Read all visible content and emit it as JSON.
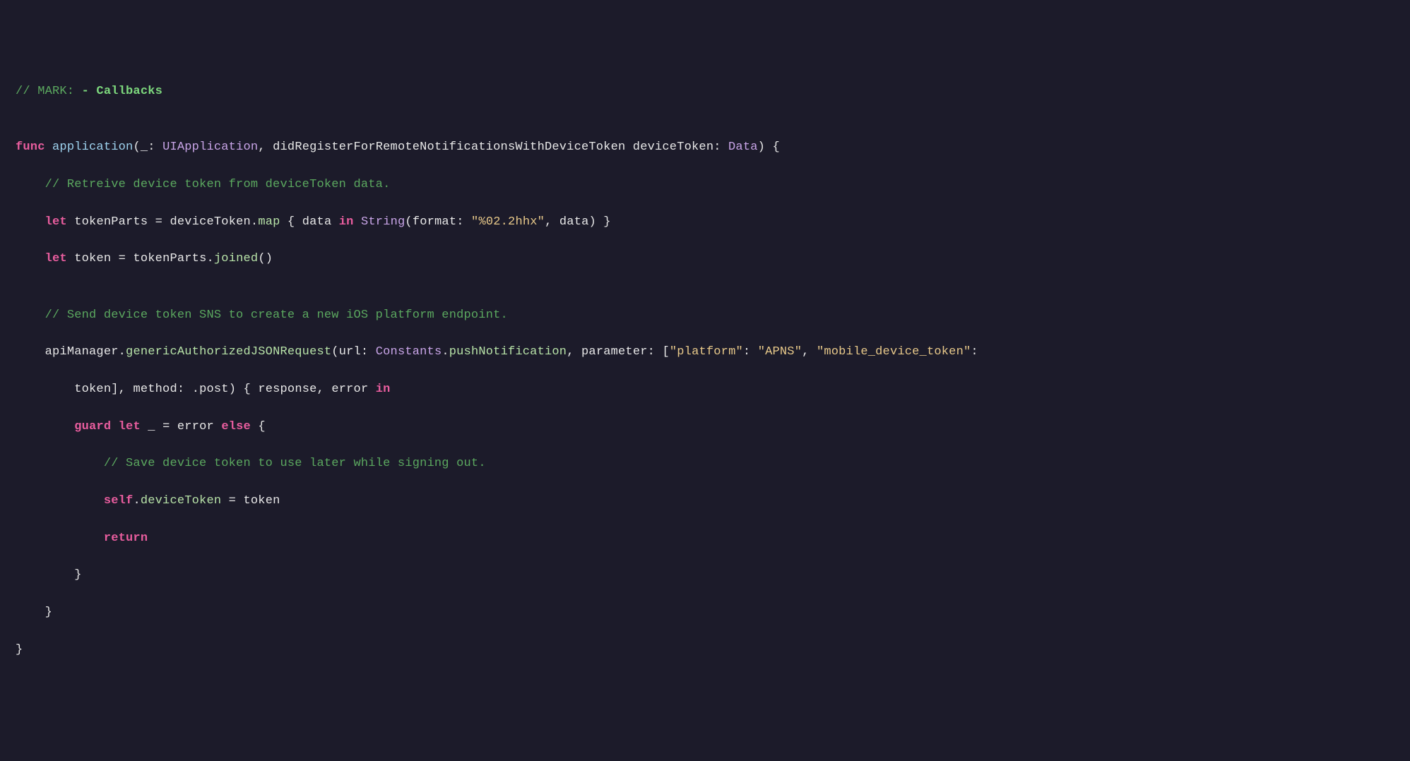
{
  "code": {
    "c1_prefix": "// MARK: ",
    "c1_bold": "- Callbacks",
    "kw_func": "func",
    "fn_application": "application",
    "p_open": "(",
    "underscore": "_",
    "colon_sp": ": ",
    "t_uiapplication": "UIApplication",
    "comma_sp": ", ",
    "pl_didregister": "didRegisterForRemoteNotificationsWithDeviceToken",
    "sp": " ",
    "pn_devicetoken": "deviceToken",
    "t_data": "Data",
    "p_close_brace": ") {",
    "c2": "// Retreive device token from deviceToken data.",
    "kw_let": "let",
    "v_tokenparts": "tokenParts",
    "eq": " = ",
    "v_devicetoken": "deviceToken",
    "dot": ".",
    "m_map": "map",
    "brace_sp": " { ",
    "v_data": "data",
    "kw_in": "in",
    "t_string": "String",
    "pl_format": "format",
    "s_format": "\"%02.2hhx\"",
    "p_close_brace2": ") }",
    "v_token": "token",
    "v_tokenparts2": "tokenParts",
    "m_joined": "joined",
    "parens": "()",
    "c3": "// Send device token SNS to create a new iOS platform endpoint.",
    "v_apimanager": "apiManager",
    "m_request": "genericAuthorizedJSONRequest",
    "pl_url": "url",
    "t_constants": "Constants",
    "m_pushnotif": "pushNotification",
    "pl_parameter": "parameter",
    "bracket_open": "[",
    "s_platform": "\"platform\"",
    "s_apns": "\"APNS\"",
    "s_mobiletoken": "\"mobile_device_token\"",
    "v_token2": "token",
    "bracket_close": "]",
    "pl_method": "method",
    "dot_post": ".",
    "v_post": "post",
    "v_response": "response",
    "v_error": "error",
    "kw_guard": "guard",
    "kw_else": "else",
    "brace_open": " {",
    "c4": "// Save device token to use later while signing out.",
    "kw_self": "self",
    "m_devicetoken": "deviceToken",
    "kw_return": "return",
    "brace_close": "}",
    "indent1": "    ",
    "indent2": "        ",
    "indent3": "            ",
    "indent4": "                "
  }
}
